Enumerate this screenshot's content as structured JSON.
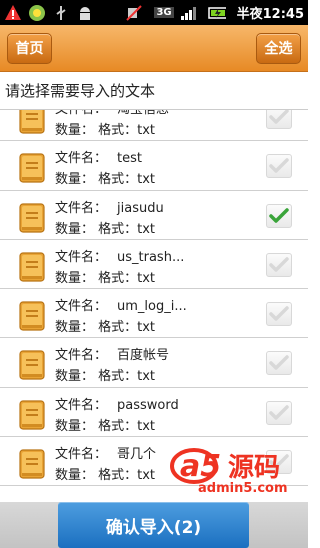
{
  "status_bar": {
    "time": "半夜12:45",
    "network": "3G",
    "icons": [
      "alert-icon",
      "qq-icon",
      "usb-icon",
      "android-icon",
      "mute-icon",
      "signal-icon",
      "battery-charging-icon"
    ]
  },
  "header": {
    "home_label": "首页",
    "select_all_label": "全选"
  },
  "prompt": "请选择需要导入的文本",
  "list": {
    "name_label": "文件名：",
    "meta_label": "数量：  格式：txt",
    "items": [
      {
        "name": "淘宝信息",
        "checked": false
      },
      {
        "name": "test",
        "checked": false
      },
      {
        "name": "jiasudu",
        "checked": true
      },
      {
        "name": "us_trash...",
        "checked": false
      },
      {
        "name": "um_log_i...",
        "checked": false
      },
      {
        "name": "百度帐号",
        "checked": false
      },
      {
        "name": "password",
        "checked": false
      },
      {
        "name": "哥几个",
        "checked": false
      }
    ]
  },
  "confirm_label": "确认导入(2)",
  "watermark": {
    "brand": "a5源码",
    "site": "admin5.com"
  },
  "colors": {
    "header_orange": "#e98c28",
    "confirm_blue": "#2a7ccc",
    "check_green": "#3aa43a"
  }
}
